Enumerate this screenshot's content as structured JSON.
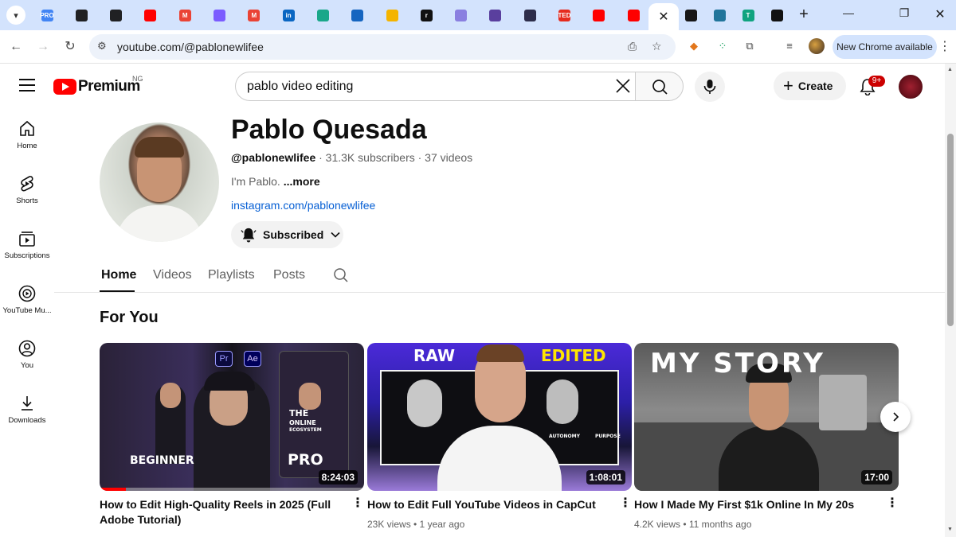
{
  "browser": {
    "tabs": [
      {
        "icon": "dropin-icon",
        "color": "#4285f4",
        "text": "PRO"
      },
      {
        "icon": "chatgpt-icon",
        "color": "#202123",
        "text": ""
      },
      {
        "icon": "chatgpt-icon",
        "color": "#202123",
        "text": ""
      },
      {
        "icon": "youtube-icon",
        "color": "#ff0000",
        "text": ""
      },
      {
        "icon": "gmail-icon",
        "color": "#ea4335",
        "text": "M"
      },
      {
        "icon": "stack-icon",
        "color": "#7b5cff",
        "text": ""
      },
      {
        "icon": "gmail-icon",
        "color": "#ea4335",
        "text": "M"
      },
      {
        "icon": "linkedin-icon",
        "color": "#0a66c2",
        "text": "in"
      },
      {
        "icon": "perplexity-icon",
        "color": "#1aa78a",
        "text": ""
      },
      {
        "icon": "network-icon",
        "color": "#1565c0",
        "text": ""
      },
      {
        "icon": "slides-icon",
        "color": "#f4b400",
        "text": ""
      },
      {
        "icon": "r-icon",
        "color": "#111111",
        "text": "r"
      },
      {
        "icon": "gemini-icon",
        "color": "#8a7fe0",
        "text": ""
      },
      {
        "icon": "delta-icon",
        "color": "#5a3f9e",
        "text": ""
      },
      {
        "icon": "circle-icon",
        "color": "#2d2d4a",
        "text": ""
      },
      {
        "icon": "ted-icon",
        "color": "#e62b1e",
        "text": "TED"
      },
      {
        "icon": "youtube-icon",
        "color": "#ff0000",
        "text": ""
      },
      {
        "icon": "youtube-icon",
        "color": "#ff0000",
        "text": ""
      },
      {
        "icon": "link-icon",
        "color": "#1a73e8",
        "text": ""
      }
    ],
    "after_tabs": [
      {
        "icon": "github-icon",
        "color": "#181717",
        "text": ""
      },
      {
        "icon": "wordpress-icon",
        "color": "#21759b",
        "text": ""
      },
      {
        "icon": "t-icon",
        "color": "#10a37f",
        "text": "T"
      },
      {
        "icon": "bar-icon",
        "color": "#111111",
        "text": ""
      }
    ],
    "url": "youtube.com/@pablonewlifee",
    "update_label": "New Chrome available"
  },
  "masthead": {
    "logo_text": "Premium",
    "country": "NG",
    "search_query": "pablo video editing",
    "create_label": "Create",
    "notif_count": "9+"
  },
  "guide": [
    {
      "label": "Home",
      "icon": "home-icon"
    },
    {
      "label": "Shorts",
      "icon": "shorts-icon"
    },
    {
      "label": "Subscriptions",
      "icon": "subscriptions-icon"
    },
    {
      "label": "YouTube Mu...",
      "icon": "youtube-music-icon"
    },
    {
      "label": "You",
      "icon": "you-icon"
    },
    {
      "label": "Downloads",
      "icon": "downloads-icon"
    }
  ],
  "channel": {
    "name": "Pablo Quesada",
    "handle": "@pablonewlifee",
    "stats": " · 31.3K subscribers · 37 videos",
    "description": "I'm Pablo. ",
    "more": "...more",
    "link": "instagram.com/pablonewlifee",
    "subscribed_label": "Subscribed",
    "tabs": [
      "Home",
      "Videos",
      "Playlists",
      "Posts"
    ]
  },
  "section": {
    "title": "For You"
  },
  "videos": [
    {
      "title": "How to Edit High-Quality Reels in 2025 (Full Adobe Tutorial)",
      "meta": "",
      "duration": "8:24:03",
      "progress": 0.1,
      "thumb_labels": [
        "Pr",
        "Ae",
        "BEGINNER",
        "PRO",
        "THE",
        "ONLINE",
        "ECOSYSTEM"
      ]
    },
    {
      "title": "How to Edit Full YouTube Videos in CapCut",
      "meta": "23K views • 1 year ago",
      "duration": "1:08:01",
      "thumb_labels": [
        "RAW",
        "EDITED",
        "AUTONOMY",
        "PURPOSE"
      ]
    },
    {
      "title": "How I Made My First $1k Online In My 20s",
      "meta": "4.2K views • 11 months ago",
      "duration": "17:00",
      "thumb_labels": [
        "MY STORY"
      ]
    }
  ]
}
